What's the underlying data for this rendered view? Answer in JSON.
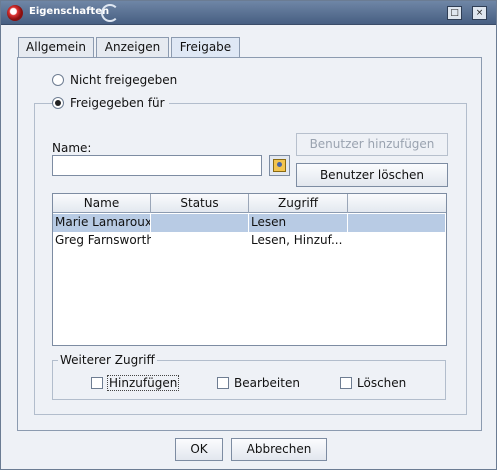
{
  "window": {
    "title": "Eigenschaften",
    "maximize_glyph": "□",
    "close_glyph": "×"
  },
  "tabs": [
    {
      "label": "Allgemein",
      "active": false
    },
    {
      "label": "Anzeigen",
      "active": false
    },
    {
      "label": "Freigabe",
      "active": true
    }
  ],
  "sharing": {
    "not_shared_label": "Nicht freigegeben",
    "shared_for_label": "Freigegeben für",
    "selected": "shared_for",
    "name_label": "Name:",
    "name_value": "",
    "add_user_label": "Benutzer hinzufügen",
    "add_user_enabled": false,
    "delete_user_label": "Benutzer löschen"
  },
  "table": {
    "columns": [
      "Name",
      "Status",
      "Zugriff",
      ""
    ],
    "rows": [
      {
        "name": "Marie Lamaroux",
        "status": "",
        "access": "Lesen",
        "extra": "",
        "selected": true
      },
      {
        "name": "Greg Farnsworth",
        "status": "",
        "access": "Lesen, Hinzuf...",
        "extra": "",
        "selected": false
      }
    ]
  },
  "further_access": {
    "legend": "Weiterer Zugriff",
    "options": [
      {
        "label": "Hinzufügen",
        "checked": false,
        "focused": true
      },
      {
        "label": "Bearbeiten",
        "checked": false,
        "focused": false
      },
      {
        "label": "Löschen",
        "checked": false,
        "focused": false
      }
    ]
  },
  "footer": {
    "ok_label": "OK",
    "cancel_label": "Abbrechen"
  },
  "colors": {
    "titlebar": "#5a7194",
    "selection": "#b8cbe4",
    "background": "#eef1f6"
  }
}
